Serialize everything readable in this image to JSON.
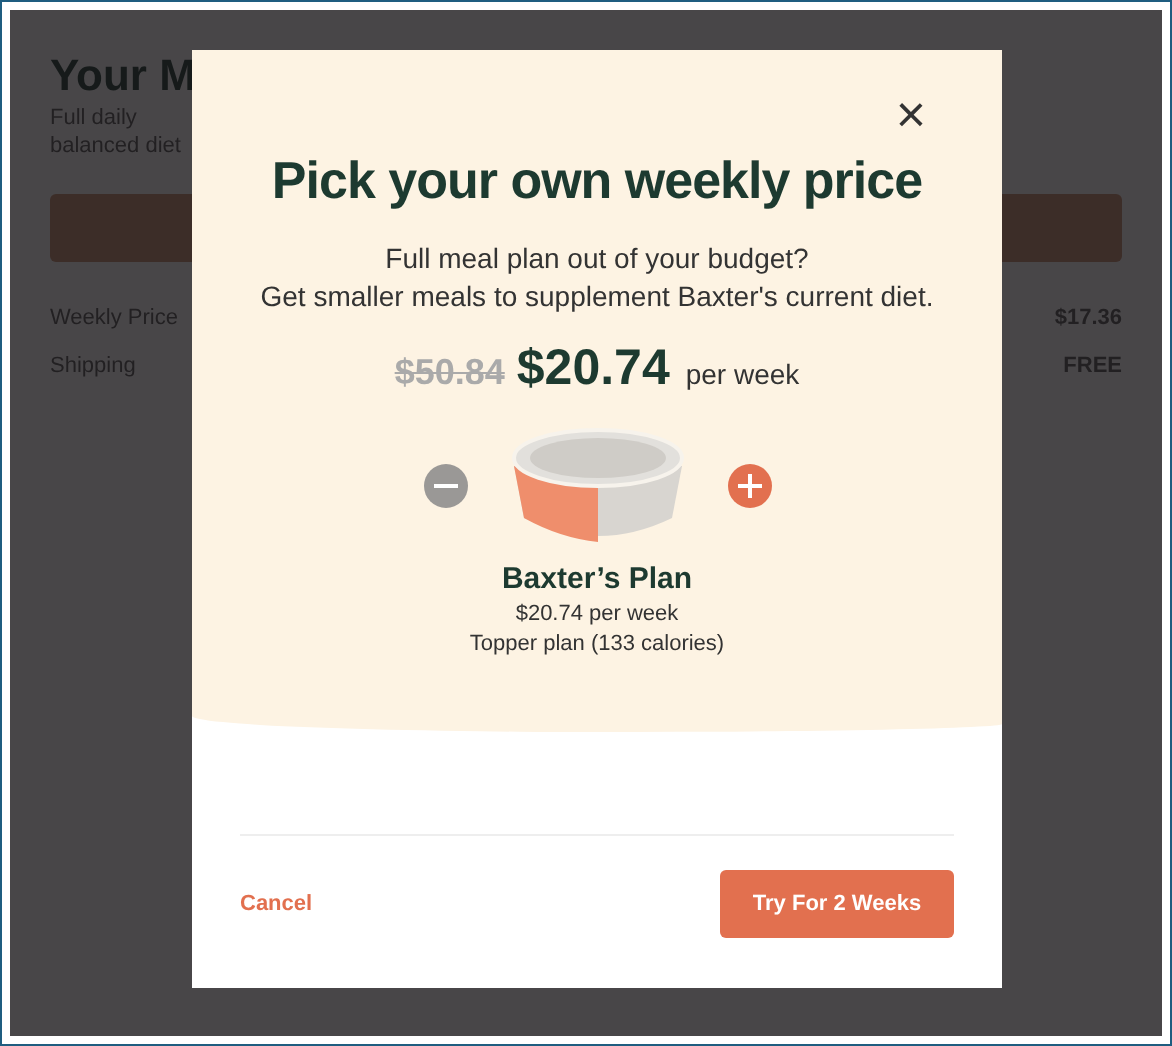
{
  "background_page": {
    "title": "Your M",
    "subtitle_lines": [
      "Full daily",
      "balanced diet"
    ],
    "rows": [
      {
        "label": "Weekly Price",
        "value": "$17.36"
      },
      {
        "label": "Shipping",
        "value": "FREE"
      }
    ]
  },
  "modal": {
    "close": "×",
    "title": "Pick your own weekly price",
    "description": [
      "Full meal plan out of your budget?",
      "Get smaller meals to supplement Baxter's current diet."
    ],
    "price": {
      "original": "$50.84",
      "current": "$20.74",
      "unit": "per week"
    },
    "stepper": {
      "decrease": {
        "disabled": true
      },
      "increase": {
        "disabled": false
      }
    },
    "plan": {
      "name": "Baxter’s Plan",
      "price": "$20.74 per week",
      "detail": "Topper plan (133 calories)"
    },
    "cancel": "Cancel",
    "confirm": "Try For 2 Weeks"
  }
}
